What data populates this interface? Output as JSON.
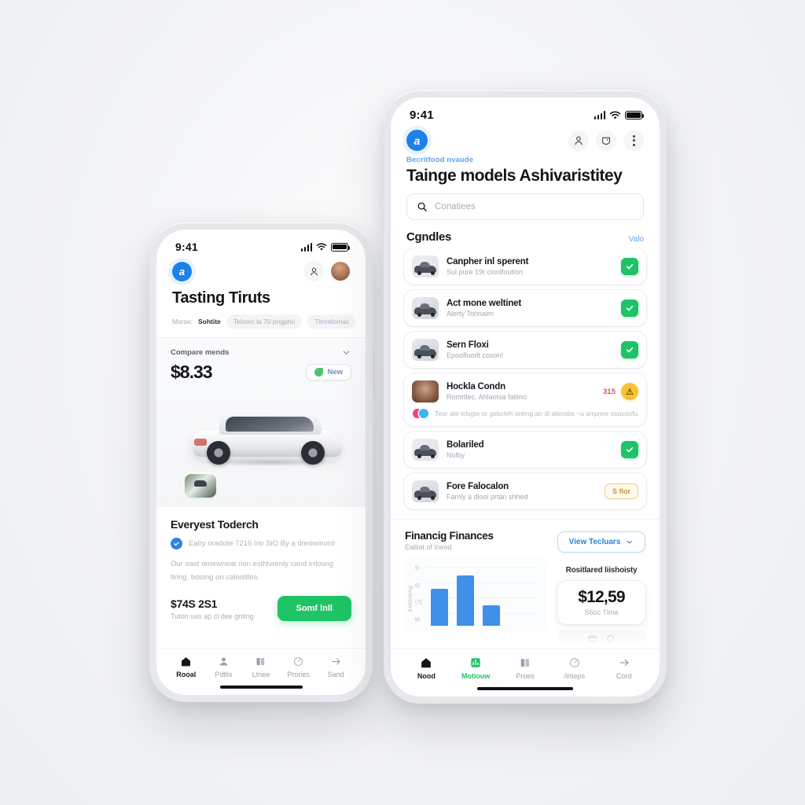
{
  "left_phone": {
    "statusbar": {
      "time": "9:41"
    },
    "appbar": {
      "brand_initial": "a",
      "profile_icon": "person-icon",
      "avatar": "avatar"
    },
    "page_title": "Tasting Tiruts",
    "chips": [
      {
        "label": "Morse:"
      },
      {
        "label": "Sohtite"
      },
      {
        "label": "Telsorc la 70 pngpho"
      },
      {
        "label": "Timrelomac"
      }
    ],
    "hero": {
      "compare_label": "Compare mends",
      "price": "$8.33",
      "badge": "New"
    },
    "detail": {
      "title": "Everyest Toderch",
      "verified_text": "Ealry oradote  7216 lrlo SiO   By a dreowinord",
      "description": "Our oast renewneat rion esthlvrenly cand irrlosng tlring. bdoing on caloolttes.",
      "cta_price": "$74S 2S1",
      "cta_sub": "Tuton uas ap cl dee goting",
      "cta_label": "Somf lnll"
    },
    "tabs": [
      {
        "label": "Rooal",
        "icon": "home-icon",
        "state": "active"
      },
      {
        "label": "Pdtlis",
        "icon": "people-icon",
        "state": ""
      },
      {
        "label": "Ltnee",
        "icon": "book-icon",
        "state": ""
      },
      {
        "label": "Prories",
        "icon": "gauge-icon",
        "state": ""
      },
      {
        "label": "Sand",
        "icon": "arrow-right-icon",
        "state": ""
      }
    ]
  },
  "right_phone": {
    "statusbar": {
      "time": "9:41"
    },
    "appbar": {
      "brand_initial": "a",
      "person_icon": "person-icon",
      "shield_icon": "shield-icon",
      "menu_icon": "kebab-menu-icon"
    },
    "eyebrow": "Becritfood nvaude",
    "page_title": "Tainge models Ashivaristitey",
    "search": {
      "placeholder": "Conatiees",
      "icon": "search-icon"
    },
    "section": {
      "title": "Cgndles",
      "more": "Valo"
    },
    "list": [
      {
        "title": "Canpher inl sperent",
        "subtitle": "Sul pure 19r clonlfoution",
        "status": "check",
        "thumb": "car-thumb"
      },
      {
        "title": "Act mone weltinet",
        "subtitle": "Alerty Torlnaen",
        "status": "check",
        "thumb": "car-thumb"
      },
      {
        "title": "Sern Floxi",
        "subtitle": "Epoofluorlt coson!",
        "status": "check",
        "thumb": "car-thumb"
      },
      {
        "title": "Hockla Condn",
        "subtitle": "Romrtlec, Ahlaotsa fatlino",
        "status": "warn-round",
        "status_icon": "alert-icon",
        "price": "315",
        "thumb": "avatar-thumb",
        "extra": {
          "dots": [
            "#e8467c",
            "#3ab7ef"
          ],
          "text": "Teor ate lclsgte or gebcleh onlrng an dl alecobs ~u arrpnne osocoofu"
        }
      },
      {
        "title": "Bolariled",
        "subtitle": "Nolby",
        "status": "check",
        "thumb": "car-thumb"
      },
      {
        "title": "Fore Falocalon",
        "subtitle": "Famly a dlool prtan shhed",
        "status": "pill",
        "pill_label": "S flor",
        "thumb": "car-thumb"
      }
    ],
    "financing": {
      "title": "Financig Finances",
      "subtitle": "Ealtiat of lneod",
      "view_button": "View Tecluars",
      "right_label": "Rositlared liishoisty",
      "amount": "$12,59",
      "amount_sub": "S6oc Tlma"
    },
    "tabs": [
      {
        "label": "Nood",
        "icon": "home-icon",
        "state": "active"
      },
      {
        "label": "Motiouw",
        "icon": "chart-icon",
        "state": "active-green"
      },
      {
        "label": "Proes",
        "icon": "book-icon",
        "state": ""
      },
      {
        "label": "/irtieps",
        "icon": "gauge-icon",
        "state": ""
      },
      {
        "label": "Cord",
        "icon": "arrow-right-icon",
        "state": ""
      }
    ]
  },
  "chart_data": {
    "type": "bar",
    "title": "Financig Finances",
    "subtitle": "Ealtiat of lneod",
    "categories": [
      "",
      "",
      ""
    ],
    "values": [
      60,
      82,
      33
    ],
    "ylim": [
      0,
      100
    ],
    "ylabel": "Antthteng",
    "ytick_labels": [
      "5-",
      "6)",
      "(7)",
      "td"
    ],
    "bar_color": "#3f90e8",
    "grid": true,
    "legend": "none"
  }
}
